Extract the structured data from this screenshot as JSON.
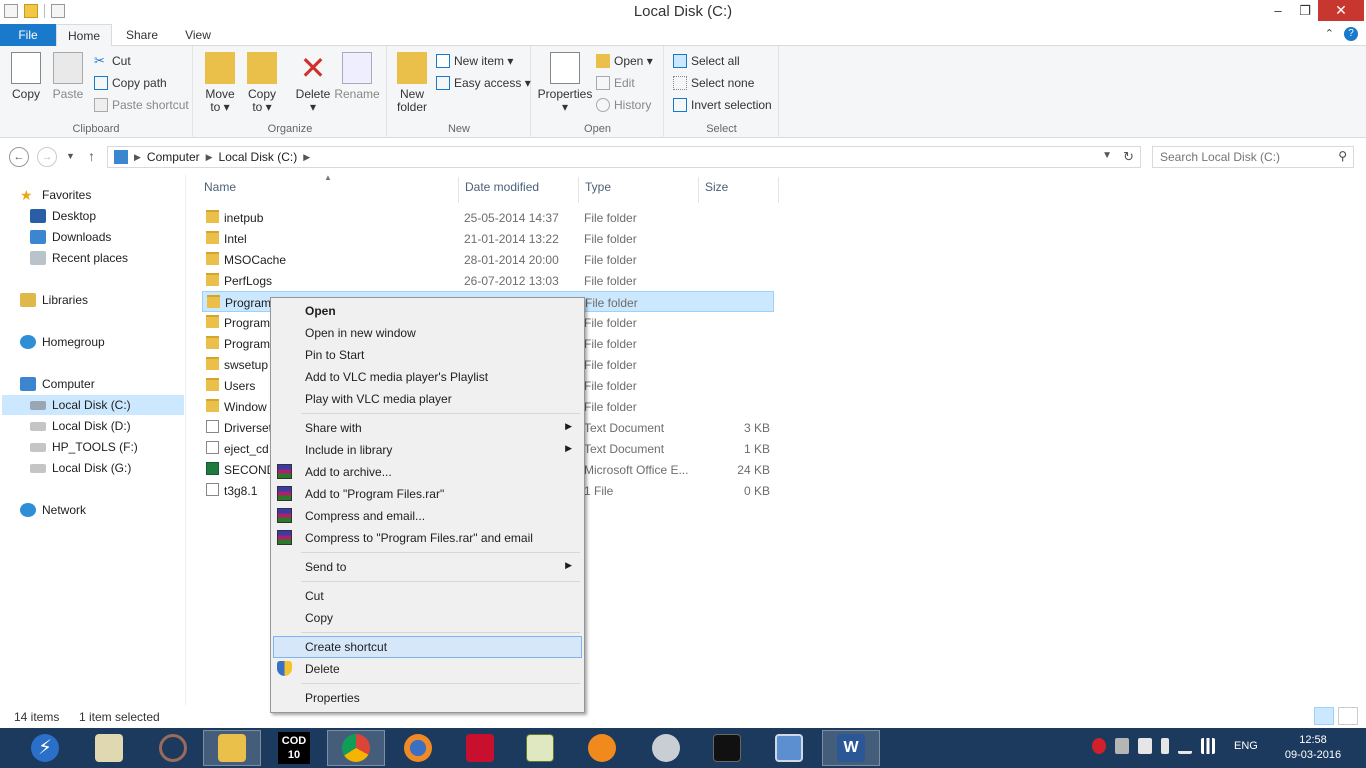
{
  "window": {
    "title": "Local Disk (C:)",
    "min": "–",
    "max": "❐",
    "close": "✕"
  },
  "ribbon_tabs": [
    "File",
    "Home",
    "Share",
    "View"
  ],
  "help_icon": "?",
  "ribbon": {
    "clipboard": {
      "label": "Clipboard",
      "copy": "Copy",
      "paste": "Paste",
      "cut": "Cut",
      "copy_path": "Copy path",
      "paste_shortcut": "Paste shortcut"
    },
    "organize": {
      "label": "Organize",
      "move_to": "Move to ▾",
      "copy_to": "Copy to ▾",
      "delete": "Delete ▾",
      "rename": "Rename"
    },
    "new": {
      "label": "New",
      "new_folder": "New folder",
      "new_item": "New item ▾",
      "easy_access": "Easy access ▾"
    },
    "open": {
      "label": "Open",
      "properties": "Properties ▾",
      "open": "Open ▾",
      "edit": "Edit",
      "history": "History"
    },
    "select": {
      "label": "Select",
      "select_all": "Select all",
      "select_none": "Select none",
      "invert_selection": "Invert selection"
    }
  },
  "address": {
    "crumbs": [
      "Computer",
      "Local Disk (C:)"
    ],
    "search_placeholder": "Search Local Disk (C:)"
  },
  "nav": {
    "favorites": "Favorites",
    "desktop": "Desktop",
    "downloads": "Downloads",
    "recent_places": "Recent places",
    "libraries": "Libraries",
    "homegroup": "Homegroup",
    "computer": "Computer",
    "local_c": "Local Disk (C:)",
    "local_d": "Local Disk (D:)",
    "hp_tools": "HP_TOOLS (F:)",
    "local_g": "Local Disk  (G:)",
    "network": "Network"
  },
  "columns": [
    "Name",
    "Date modified",
    "Type",
    "Size"
  ],
  "files": [
    {
      "name": "inetpub",
      "date": "25-05-2014 14:37",
      "type": "File folder",
      "size": "",
      "icon": "folder-icon"
    },
    {
      "name": "Intel",
      "date": "21-01-2014 13:22",
      "type": "File folder",
      "size": "",
      "icon": "folder-icon"
    },
    {
      "name": "MSOCache",
      "date": "28-01-2014 20:00",
      "type": "File folder",
      "size": "",
      "icon": "folder-icon"
    },
    {
      "name": "PerfLogs",
      "date": "26-07-2012 13:03",
      "type": "File folder",
      "size": "",
      "icon": "folder-icon"
    },
    {
      "name": "Program",
      "date": "",
      "type": "File folder",
      "size": "",
      "icon": "folder-icon"
    },
    {
      "name": "Program",
      "date": "",
      "type": "File folder",
      "size": "",
      "icon": "folder-icon"
    },
    {
      "name": "Program",
      "date": "",
      "type": "File folder",
      "size": "",
      "icon": "folder-icon"
    },
    {
      "name": "swsetup",
      "date": "",
      "type": "File folder",
      "size": "",
      "icon": "folder-icon"
    },
    {
      "name": "Users",
      "date": "",
      "type": "File folder",
      "size": "",
      "icon": "folder-icon"
    },
    {
      "name": "Window",
      "date": "",
      "type": "File folder",
      "size": "",
      "icon": "folder-icon"
    },
    {
      "name": "Driverset",
      "date": "",
      "type": "Text Document",
      "size": "3 KB",
      "icon": "text-file-icon"
    },
    {
      "name": "eject_cd",
      "date": "",
      "type": "Text Document",
      "size": "1 KB",
      "icon": "text-file-icon"
    },
    {
      "name": "SECOND",
      "date": "",
      "type": "Microsoft Office E...",
      "size": "24 KB",
      "icon": "excel-file-icon"
    },
    {
      "name": "t3g8.1",
      "date": "",
      "type": "1 File",
      "size": "0 KB",
      "icon": "file-icon"
    }
  ],
  "context_menu": {
    "open": "Open",
    "open_new_window": "Open in new window",
    "pin_to_start": "Pin to Start",
    "add_vlc_playlist": "Add to VLC media player's Playlist",
    "play_vlc": "Play with VLC media player",
    "share_with": "Share with",
    "include_in_library": "Include in library",
    "add_to_archive": "Add to archive...",
    "add_to_rar": "Add to \"Program Files.rar\"",
    "compress_email": "Compress and email...",
    "compress_rar_email": "Compress to \"Program Files.rar\" and email",
    "send_to": "Send to",
    "cut": "Cut",
    "copy": "Copy",
    "create_shortcut": "Create shortcut",
    "delete": "Delete",
    "properties": "Properties"
  },
  "status": {
    "item_count": "14 items",
    "selected": "1 item selected"
  },
  "taskbar": {
    "cod_label_top": "COD",
    "cod_label_bottom": "10",
    "lang": "ENG",
    "time": "12:58",
    "date": "09-03-2016"
  },
  "colors": {
    "accent": "#1979ca",
    "selection": "#cce8ff",
    "taskbar": "#1c3a5e",
    "close": "#c7372f"
  }
}
